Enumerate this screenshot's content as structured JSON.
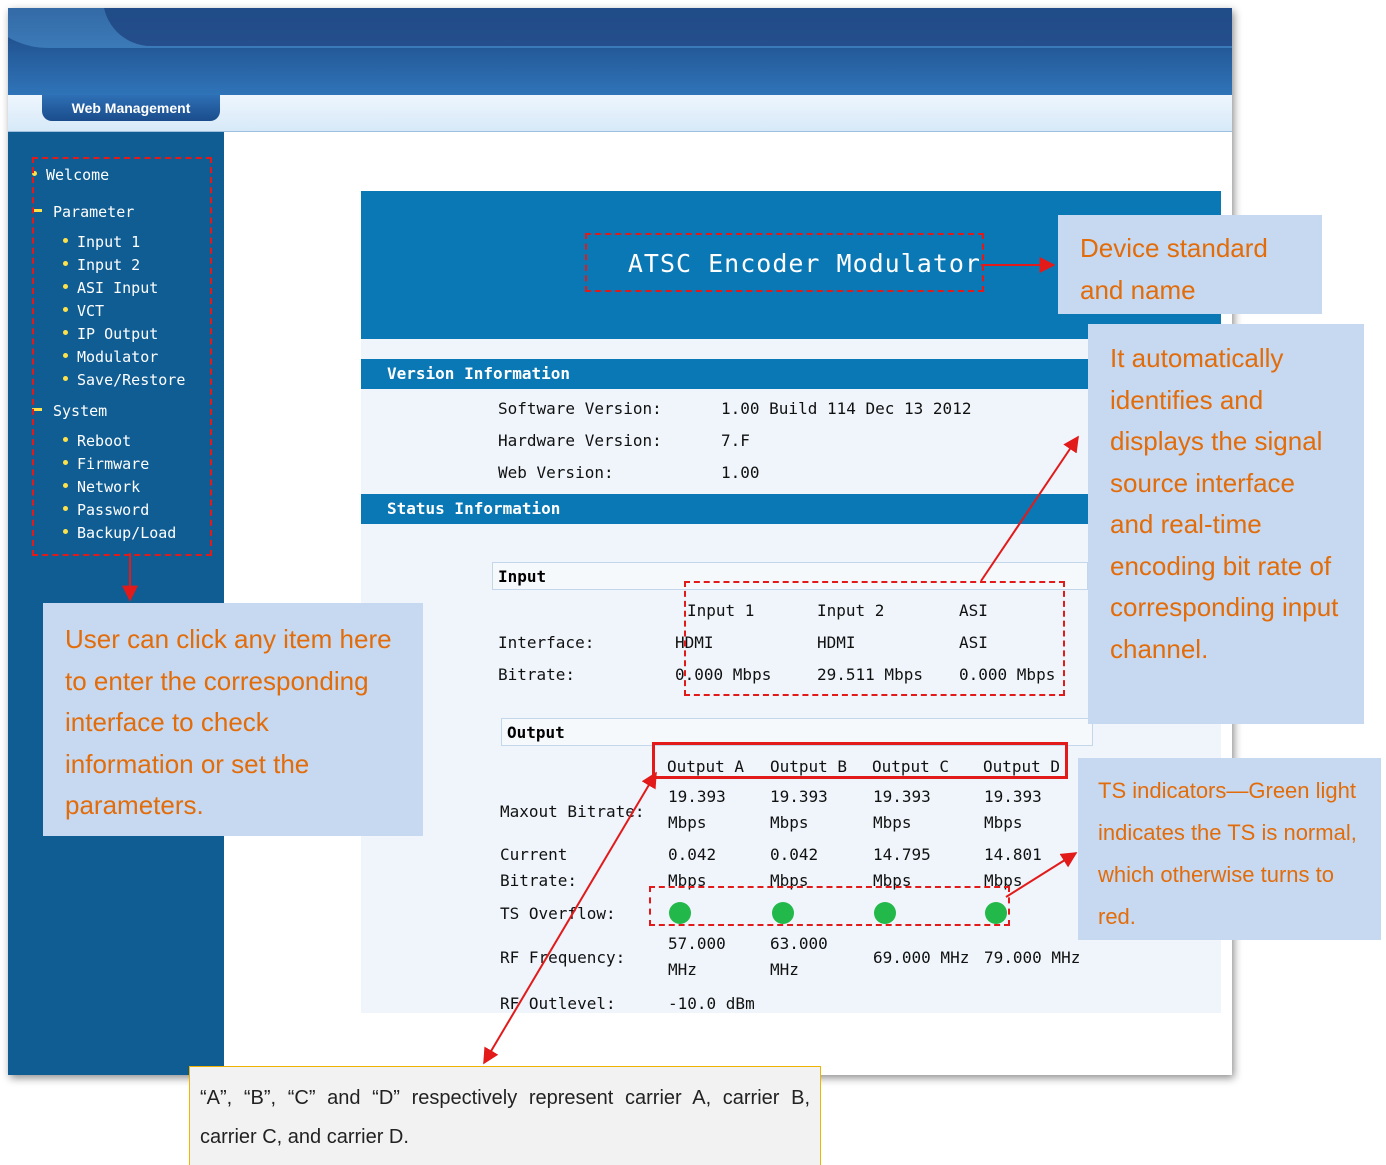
{
  "tab": {
    "label": "Web Management"
  },
  "sidebar": {
    "welcome": "Welcome",
    "parameter_group": "Parameter",
    "parameter_items": [
      "Input 1",
      "Input 2",
      "ASI Input",
      "VCT",
      "IP Output",
      "Modulator",
      "Save/Restore"
    ],
    "system_group": "System",
    "system_items": [
      "Reboot",
      "Firmware",
      "Network",
      "Password",
      "Backup/Load"
    ]
  },
  "device": {
    "title": "ATSC Encoder Modulator"
  },
  "version_info": {
    "title": "Version Information",
    "software_label": "Software Version:",
    "software_value": "1.00 Build 114 Dec 13 2012",
    "hardware_label": "Hardware Version:",
    "hardware_value": "7.F",
    "web_label": "Web Version:",
    "web_value": "1.00"
  },
  "status_info": {
    "title": "Status Information",
    "input": {
      "title": "Input",
      "columns": [
        "Input 1",
        "Input 2",
        "ASI"
      ],
      "interface_label": "Interface:",
      "interface_values": [
        "HDMI",
        "HDMI",
        "ASI"
      ],
      "bitrate_label": "Bitrate:",
      "bitrate_values": [
        "0.000 Mbps",
        "29.511 Mbps",
        "0.000 Mbps"
      ]
    },
    "output": {
      "title": "Output",
      "columns": [
        "Output A",
        "Output B",
        "Output C",
        "Output D"
      ],
      "maxout_label": "Maxout Bitrate:",
      "maxout_values": [
        "19.393",
        "19.393",
        "19.393",
        "19.393"
      ],
      "current_label_1": "Current",
      "current_label_2": "Bitrate:",
      "current_values": [
        "0.042",
        "0.042",
        "14.795",
        "14.801"
      ],
      "unit": "Mbps",
      "ts_overflow_label": "TS Overflow:",
      "ts_overflow_status": [
        "normal",
        "normal",
        "normal",
        "normal"
      ],
      "led_color": "#23b84a",
      "rf_frequency_label": "RF Frequency:",
      "rf_frequency_values": [
        "57.000",
        "63.000",
        "69.000 MHz",
        "79.000 MHz"
      ],
      "rf_frequency_unit": "MHz",
      "rf_outlevel_label": "RF Outlevel:",
      "rf_outlevel_value": "-10.0 dBm"
    }
  },
  "annotations": {
    "sidebar_note": "User can click any item here to enter the corresponding interface to check information or set the parameters.",
    "device_note": "Device  standard and name",
    "input_note": "It automatically identifies and displays the signal source interface and real-time encoding bit rate of corresponding input channel.",
    "ts_note": "TS indicators—Green light indicates the TS is normal, which otherwise turns to red.",
    "carrier_note": "“A”, “B”, “C” and “D” respectively represent carrier A, carrier B, carrier C, and carrier D."
  },
  "colors": {
    "annotation_red": "#e21a1a",
    "note_background": "#c6d9f0",
    "note_text": "#e36c0a",
    "header_blue": "#0a78b5",
    "sidebar_blue": "#0f5d93"
  }
}
